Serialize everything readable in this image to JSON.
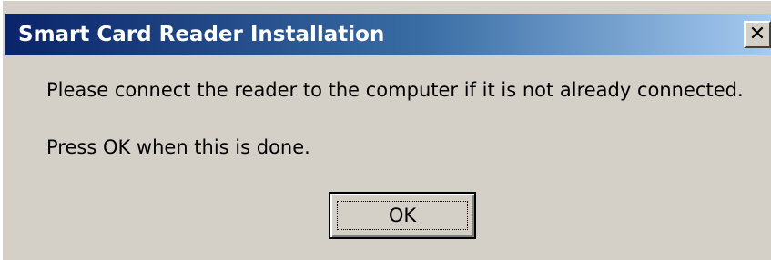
{
  "dialog": {
    "title": "Smart Card Reader Installation",
    "close_icon": "close-icon",
    "close_glyph": "✕",
    "message_line1": "Please connect the reader to the computer if it is not already connected.",
    "message_line2": "Press OK when this is done.",
    "ok_label": "OK"
  },
  "colors": {
    "title_gradient_start": "#0a246a",
    "title_gradient_end": "#a6caf0",
    "dialog_face": "#d4d0c8"
  }
}
